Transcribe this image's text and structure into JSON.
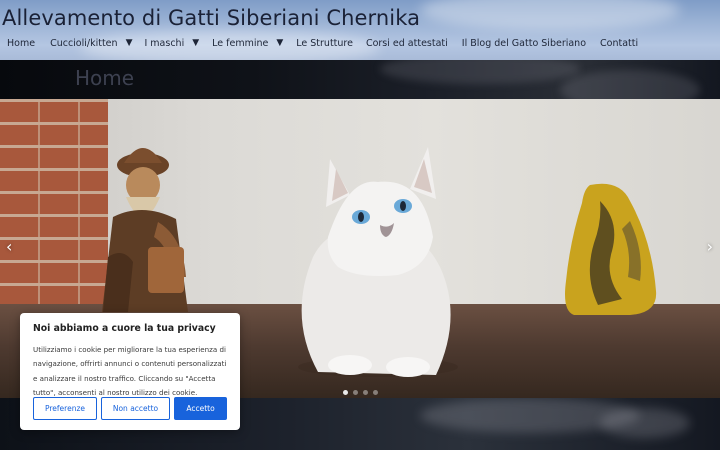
{
  "header": {
    "site_title": "Allevamento di Gatti Siberiani Chernika"
  },
  "nav": {
    "items": [
      {
        "label": "Home",
        "has_dropdown": false
      },
      {
        "label": "Cuccioli/kitten",
        "has_dropdown": true
      },
      {
        "label": "I maschi",
        "has_dropdown": true
      },
      {
        "label": "Le femmine",
        "has_dropdown": true
      },
      {
        "label": "Le Strutture",
        "has_dropdown": false
      },
      {
        "label": "Corsi ed attestati",
        "has_dropdown": false
      },
      {
        "label": "Il Blog del Gatto Siberiano",
        "has_dropdown": false
      },
      {
        "label": "Contatti",
        "has_dropdown": false
      }
    ],
    "dropdown_glyph": "▼"
  },
  "page": {
    "title": "Home"
  },
  "slider": {
    "prev_glyph": "‹",
    "next_glyph": "›",
    "prev_icon": "chevron-left-icon",
    "next_icon": "chevron-right-icon",
    "slide_count": 4,
    "active_slide": 1
  },
  "cookie": {
    "title": "Noi abbiamo a cuore la tua privacy",
    "text": "Utilizziamo i cookie per migliorare la tua esperienza di navigazione, offrirti annunci o contenuti personalizzati e analizzare il nostro traffico. Cliccando su \"Accetta tutto\", acconsenti al nostro utilizzo dei cookie.",
    "buttons": {
      "preferences": "Preferenze",
      "reject": "Non accetto",
      "accept": "Accetto"
    }
  },
  "colors": {
    "accent": "#1863dc",
    "title_text": "#1a2136"
  }
}
